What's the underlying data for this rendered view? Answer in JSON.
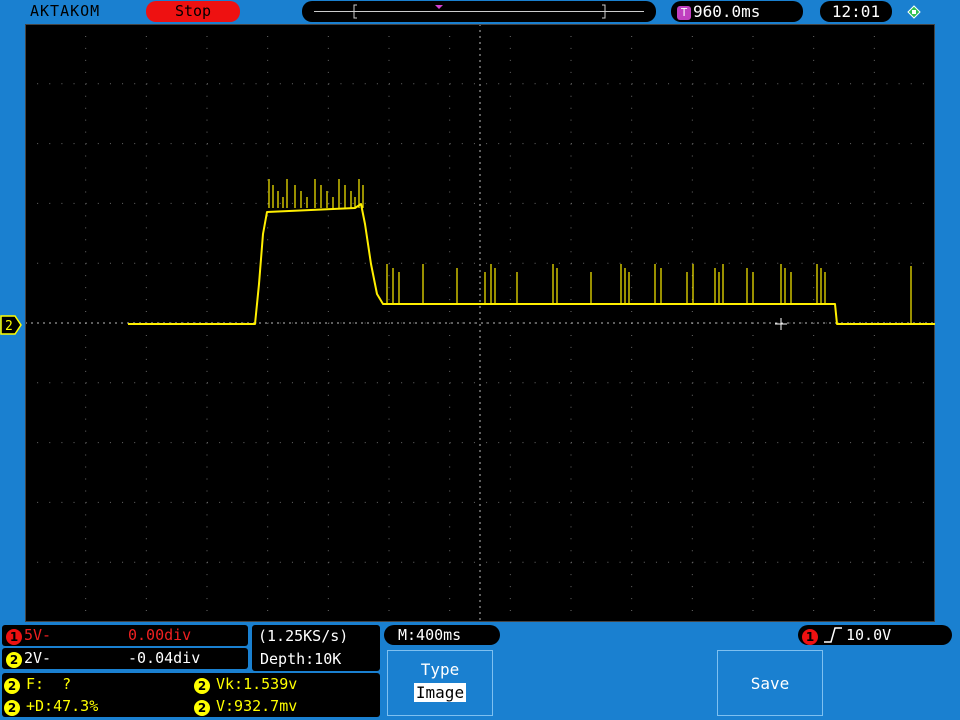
{
  "header": {
    "brand": "AKTAKOM",
    "run_state": "Stop",
    "trigger_time_badge": "T",
    "trigger_time": "960.0ms",
    "clock": "12:01",
    "usb_icon": "usb-icon"
  },
  "channels": {
    "ch1": {
      "badge": "1",
      "scale": "5V-",
      "offset": "0.00div",
      "color": "#ee1111"
    },
    "ch2": {
      "badge": "2",
      "scale": "2V-",
      "offset": "-0.04div",
      "color": "#ffff00"
    }
  },
  "ch2_marker": "2",
  "acquisition": {
    "sample_rate": "(1.25KS/s)",
    "depth": "Depth:10K"
  },
  "timebase": "M:400ms",
  "trigger": {
    "badge": "1",
    "edge_icon": "rising-edge-icon",
    "level": "10.0V"
  },
  "measurements": [
    {
      "badge": "2",
      "text": "F:  ?"
    },
    {
      "badge": "2",
      "text": "Vk:1.539v"
    },
    {
      "badge": "2",
      "text": "+D:47.3%"
    },
    {
      "badge": "2",
      "text": "V:932.7mv"
    }
  ],
  "menu": {
    "type_label": "Type",
    "type_value": "Image",
    "save_label": "Save"
  }
}
